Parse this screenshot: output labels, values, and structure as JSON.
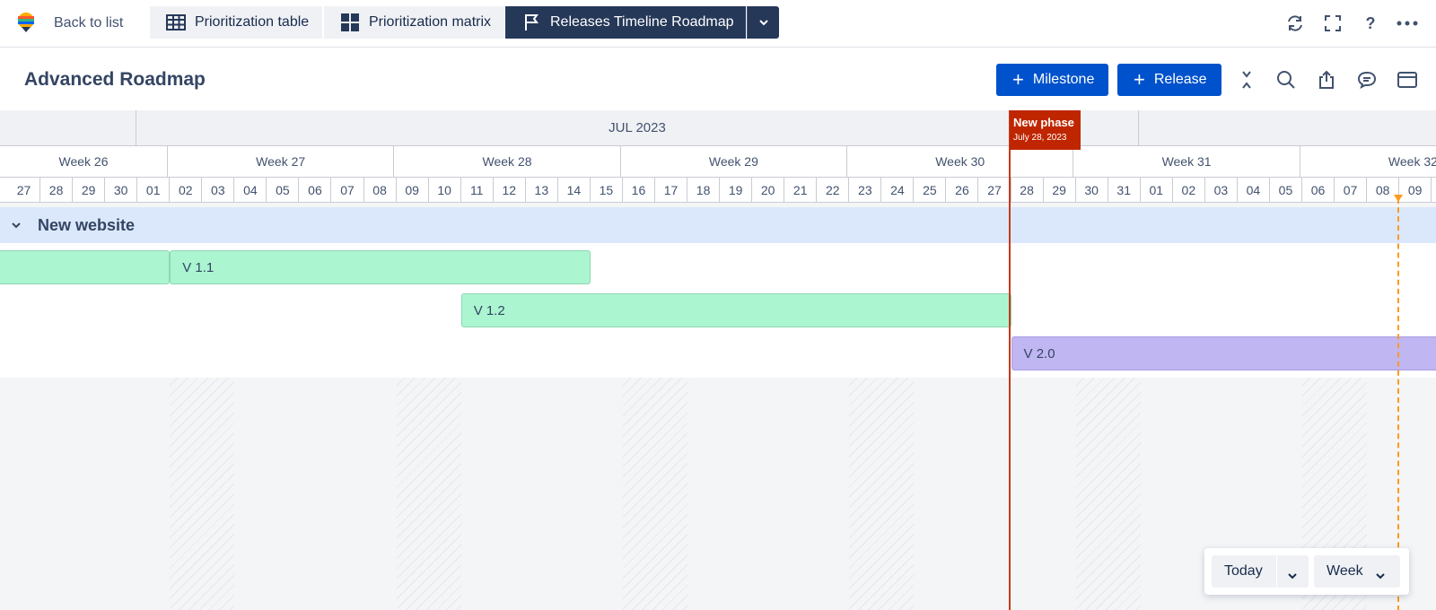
{
  "topbar": {
    "back_label": "Back to list",
    "tabs": [
      {
        "label": "Prioritization table",
        "icon": "table-icon"
      },
      {
        "label": "Prioritization matrix",
        "icon": "grid-icon"
      },
      {
        "label": "Releases Timeline Roadmap",
        "icon": "flag-icon",
        "active": true
      }
    ],
    "icons": [
      "refresh-icon",
      "fullscreen-icon",
      "help-icon",
      "more-icon"
    ],
    "help_glyph": "?"
  },
  "header": {
    "title": "Advanced Roadmap",
    "milestone_label": "Milestone",
    "release_label": "Release",
    "icons": [
      "collapse-icon",
      "search-icon",
      "share-icon",
      "comment-icon",
      "card-icon"
    ]
  },
  "timeline": {
    "month": "JUL 2023",
    "weeks": [
      "Week 26",
      "Week 27",
      "Week 28",
      "Week 29",
      "Week 30",
      "Week 31",
      "Week 32"
    ],
    "days": [
      "27",
      "28",
      "29",
      "30",
      "01",
      "02",
      "03",
      "04",
      "05",
      "06",
      "07",
      "08",
      "09",
      "10",
      "11",
      "12",
      "13",
      "14",
      "15",
      "16",
      "17",
      "18",
      "19",
      "20",
      "21",
      "22",
      "23",
      "24",
      "25",
      "26",
      "27",
      "28",
      "29",
      "30",
      "31",
      "01",
      "02",
      "03",
      "04",
      "05",
      "06",
      "07",
      "08",
      "09"
    ],
    "group": "New website",
    "bars": [
      {
        "label": "",
        "start": "2023-06-26",
        "end": "2023-06-30",
        "color": "#abf5d1"
      },
      {
        "label": "V 1.1",
        "start": "2023-07-01",
        "end": "2023-07-13",
        "color": "#abf5d1"
      },
      {
        "label": "V 1.2",
        "start": "2023-07-10",
        "end": "2023-07-26",
        "color": "#abf5d1"
      },
      {
        "label": "V 2.0",
        "start": "2023-07-27",
        "end": "2023-08-09",
        "color": "#c0b6f2"
      }
    ],
    "phase": {
      "title": "New phase",
      "date": "July 28, 2023",
      "color": "#bf2600"
    },
    "milestone_color": "#ff991f"
  },
  "controls": {
    "today_label": "Today",
    "scale_label": "Week"
  }
}
